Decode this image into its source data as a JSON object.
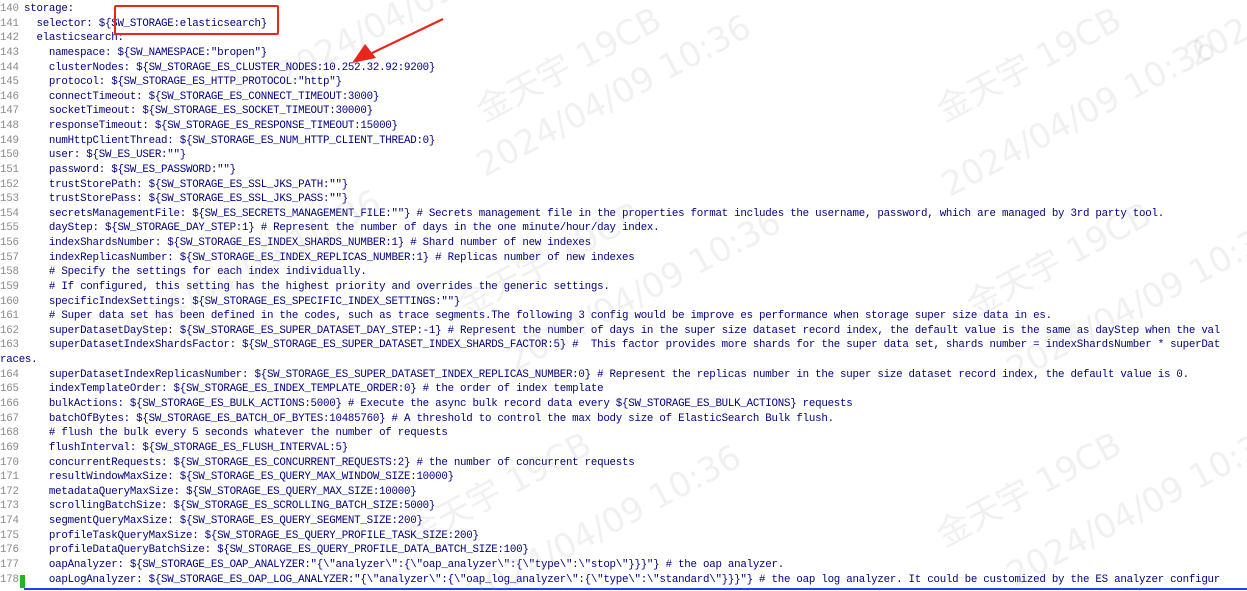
{
  "watermark": {
    "name": "金天宇 19CB",
    "date": "2024/04/09 10:36"
  },
  "annotation": {
    "box_color": "#e8261c",
    "arrow_color": "#e8261c"
  },
  "lines": [
    {
      "num": "140",
      "text": "storage:"
    },
    {
      "num": "141",
      "text": "  selector: ${SW_STORAGE:elasticsearch}"
    },
    {
      "num": "142",
      "text": "  elasticsearch:"
    },
    {
      "num": "143",
      "text": "    namespace: ${SW_NAMESPACE:\"bropen\"}"
    },
    {
      "num": "144",
      "text": "    clusterNodes: ${SW_STORAGE_ES_CLUSTER_NODES:10.252.32.92:9200}"
    },
    {
      "num": "145",
      "text": "    protocol: ${SW_STORAGE_ES_HTTP_PROTOCOL:\"http\"}"
    },
    {
      "num": "146",
      "text": "    connectTimeout: ${SW_STORAGE_ES_CONNECT_TIMEOUT:3000}"
    },
    {
      "num": "147",
      "text": "    socketTimeout: ${SW_STORAGE_ES_SOCKET_TIMEOUT:30000}"
    },
    {
      "num": "148",
      "text": "    responseTimeout: ${SW_STORAGE_ES_RESPONSE_TIMEOUT:15000}"
    },
    {
      "num": "149",
      "text": "    numHttpClientThread: ${SW_STORAGE_ES_NUM_HTTP_CLIENT_THREAD:0}"
    },
    {
      "num": "150",
      "text": "    user: ${SW_ES_USER:\"\"}"
    },
    {
      "num": "151",
      "text": "    password: ${SW_ES_PASSWORD:\"\"}"
    },
    {
      "num": "152",
      "text": "    trustStorePath: ${SW_STORAGE_ES_SSL_JKS_PATH:\"\"}"
    },
    {
      "num": "153",
      "text": "    trustStorePass: ${SW_STORAGE_ES_SSL_JKS_PASS:\"\"}"
    },
    {
      "num": "154",
      "text": "    secretsManagementFile: ${SW_ES_SECRETS_MANAGEMENT_FILE:\"\"} # Secrets management file in the properties format includes the username, password, which are managed by 3rd party tool."
    },
    {
      "num": "155",
      "text": "    dayStep: ${SW_STORAGE_DAY_STEP:1} # Represent the number of days in the one minute/hour/day index."
    },
    {
      "num": "156",
      "text": "    indexShardsNumber: ${SW_STORAGE_ES_INDEX_SHARDS_NUMBER:1} # Shard number of new indexes"
    },
    {
      "num": "157",
      "text": "    indexReplicasNumber: ${SW_STORAGE_ES_INDEX_REPLICAS_NUMBER:1} # Replicas number of new indexes"
    },
    {
      "num": "158",
      "text": "    # Specify the settings for each index individually."
    },
    {
      "num": "159",
      "text": "    # If configured, this setting has the highest priority and overrides the generic settings."
    },
    {
      "num": "160",
      "text": "    specificIndexSettings: ${SW_STORAGE_ES_SPECIFIC_INDEX_SETTINGS:\"\"}"
    },
    {
      "num": "161",
      "text": "    # Super data set has been defined in the codes, such as trace segments.The following 3 config would be improve es performance when storage super size data in es."
    },
    {
      "num": "162",
      "text": "    superDatasetDayStep: ${SW_STORAGE_ES_SUPER_DATASET_DAY_STEP:-1} # Represent the number of days in the super size dataset record index, the default value is the same as dayStep when the val"
    },
    {
      "num": "163",
      "text": "    superDatasetIndexShardsFactor: ${SW_STORAGE_ES_SUPER_DATASET_INDEX_SHARDS_FACTOR:5} #  This factor provides more shards for the super data set, shards number = indexShardsNumber * superDat"
    },
    {
      "num": "",
      "text": "races."
    },
    {
      "num": "164",
      "text": "    superDatasetIndexReplicasNumber: ${SW_STORAGE_ES_SUPER_DATASET_INDEX_REPLICAS_NUMBER:0} # Represent the replicas number in the super size dataset record index, the default value is 0."
    },
    {
      "num": "165",
      "text": "    indexTemplateOrder: ${SW_STORAGE_ES_INDEX_TEMPLATE_ORDER:0} # the order of index template"
    },
    {
      "num": "166",
      "text": "    bulkActions: ${SW_STORAGE_ES_BULK_ACTIONS:5000} # Execute the async bulk record data every ${SW_STORAGE_ES_BULK_ACTIONS} requests"
    },
    {
      "num": "167",
      "text": "    batchOfBytes: ${SW_STORAGE_ES_BATCH_OF_BYTES:10485760} # A threshold to control the max body size of ElasticSearch Bulk flush."
    },
    {
      "num": "168",
      "text": "    # flush the bulk every 5 seconds whatever the number of requests"
    },
    {
      "num": "169",
      "text": "    flushInterval: ${SW_STORAGE_ES_FLUSH_INTERVAL:5}"
    },
    {
      "num": "170",
      "text": "    concurrentRequests: ${SW_STORAGE_ES_CONCURRENT_REQUESTS:2} # the number of concurrent requests"
    },
    {
      "num": "171",
      "text": "    resultWindowMaxSize: ${SW_STORAGE_ES_QUERY_MAX_WINDOW_SIZE:10000}"
    },
    {
      "num": "172",
      "text": "    metadataQueryMaxSize: ${SW_STORAGE_ES_QUERY_MAX_SIZE:10000}"
    },
    {
      "num": "173",
      "text": "    scrollingBatchSize: ${SW_STORAGE_ES_SCROLLING_BATCH_SIZE:5000}"
    },
    {
      "num": "174",
      "text": "    segmentQueryMaxSize: ${SW_STORAGE_ES_QUERY_SEGMENT_SIZE:200}"
    },
    {
      "num": "175",
      "text": "    profileTaskQueryMaxSize: ${SW_STORAGE_ES_QUERY_PROFILE_TASK_SIZE:200}"
    },
    {
      "num": "176",
      "text": "    profileDataQueryBatchSize: ${SW_STORAGE_ES_QUERY_PROFILE_DATA_BATCH_SIZE:100}"
    },
    {
      "num": "177",
      "text": "    oapAnalyzer: ${SW_STORAGE_ES_OAP_ANALYZER:\"{\\\"analyzer\\\":{\\\"oap_analyzer\\\":{\\\"type\\\":\\\"stop\\\"}}}\"} # the oap analyzer."
    },
    {
      "num": "178",
      "text": "    oapLogAnalyzer: ${SW_STORAGE_ES_OAP_LOG_ANALYZER:\"{\\\"analyzer\\\":{\\\"oap_log_analyzer\\\":{\\\"type\\\":\\\"standard\\\"}}}\"} # the oap log analyzer. It could be customized by the ES analyzer configur"
    }
  ]
}
